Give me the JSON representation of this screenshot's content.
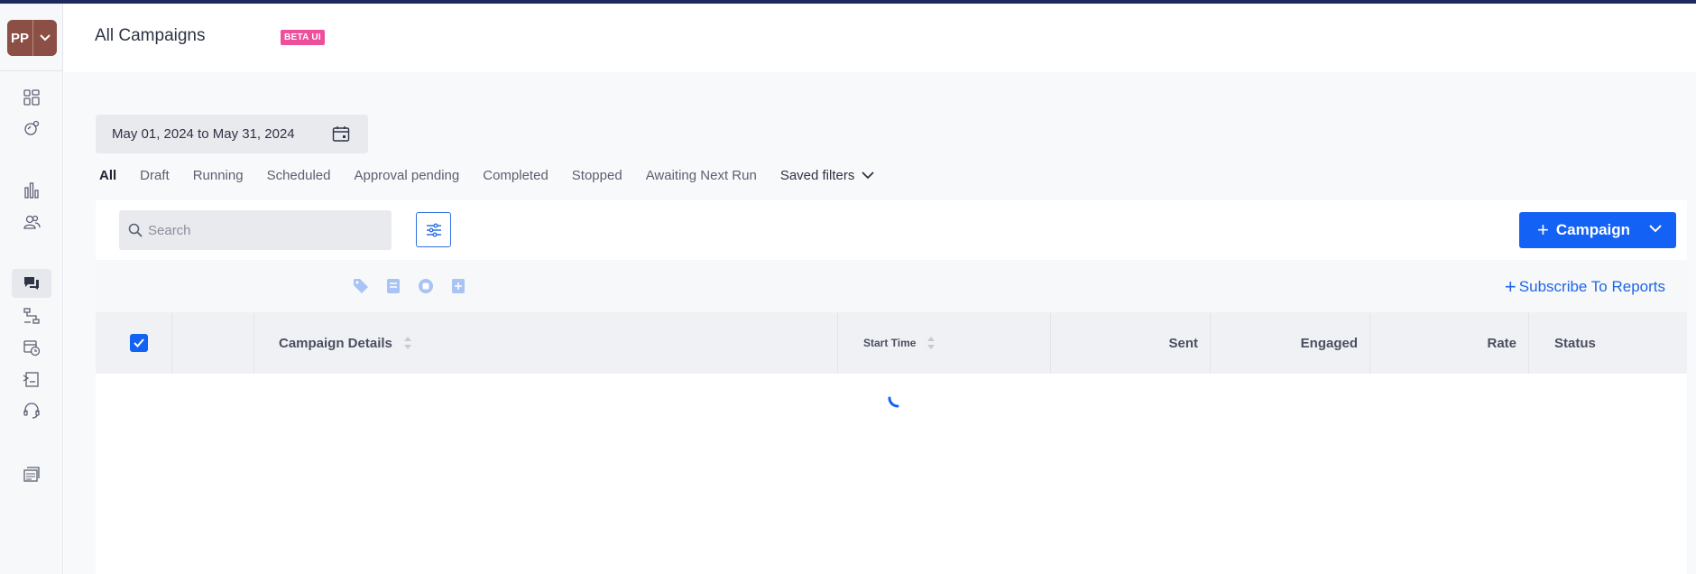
{
  "user": {
    "initials": "PP"
  },
  "header": {
    "title": "All Campaigns",
    "badge": "BETA UI"
  },
  "sidebar": {
    "icons": [
      {
        "name": "dashboard-icon",
        "active": false
      },
      {
        "name": "integrations-icon",
        "active": false
      },
      {
        "name": "analytics-icon",
        "active": false
      },
      {
        "name": "users-icon",
        "active": false
      },
      {
        "name": "campaigns-icon",
        "active": true
      },
      {
        "name": "flows-icon",
        "active": false
      },
      {
        "name": "scheduler-icon",
        "active": false
      },
      {
        "name": "templates-icon",
        "active": false
      },
      {
        "name": "support-icon",
        "active": false
      },
      {
        "name": "catalog-icon",
        "active": false
      }
    ]
  },
  "filters": {
    "date_range": "May 01, 2024 to May 31, 2024",
    "tabs": [
      "All",
      "Draft",
      "Running",
      "Scheduled",
      "Approval pending",
      "Completed",
      "Stopped",
      "Awaiting Next Run"
    ],
    "active_tab": "All",
    "saved_filters_label": "Saved filters"
  },
  "toolbar": {
    "search_placeholder": "Search",
    "search_value": "",
    "create_button_label": "Campaign",
    "subscribe_label": "Subscribe To Reports"
  },
  "table": {
    "columns": [
      "Campaign Details",
      "Start Time",
      "Sent",
      "Engaged",
      "Rate",
      "Status"
    ],
    "select_all_checked": true,
    "rows": [],
    "loading": true
  },
  "colors": {
    "accent": "#1461f5",
    "badge": "#ee4f9a",
    "avatar": "#8b4f45",
    "topbar": "#1f2a5c"
  }
}
